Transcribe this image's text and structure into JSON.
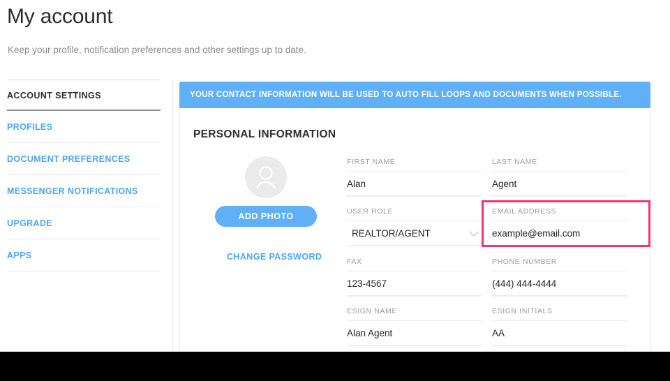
{
  "header": {
    "title": "My account",
    "subtitle": "Keep your profile, notification preferences and other settings up to date."
  },
  "sidebar": {
    "heading": "ACCOUNT SETTINGS",
    "items": [
      {
        "label": "PROFILES"
      },
      {
        "label": "DOCUMENT PREFERENCES"
      },
      {
        "label": "MESSENGER NOTIFICATIONS"
      },
      {
        "label": "UPGRADE"
      },
      {
        "label": "APPS"
      }
    ]
  },
  "card": {
    "banner": "YOUR CONTACT INFORMATION WILL BE USED TO AUTO FILL LOOPS AND DOCUMENTS WHEN POSSIBLE.",
    "section_title": "PERSONAL INFORMATION",
    "avatar": {
      "icon": "person-icon"
    },
    "add_photo_label": "ADD PHOTO",
    "change_password_label": "CHANGE PASSWORD",
    "fields": [
      {
        "label": "FIRST NAME",
        "value": "Alan"
      },
      {
        "label": "LAST NAME",
        "value": "Agent"
      },
      {
        "label": "USER ROLE",
        "value": "REALTOR/AGENT"
      },
      {
        "label": "EMAIL ADDRESS",
        "value": "example@email.com"
      },
      {
        "label": "FAX",
        "value": "123-4567"
      },
      {
        "label": "PHONE NUMBER",
        "value": "(444) 444-4444"
      },
      {
        "label": "ESIGN NAME",
        "value": "Alan Agent"
      },
      {
        "label": "ESIGN INITIALS",
        "value": "AA"
      }
    ]
  },
  "colors": {
    "accent_blue": "#61b0f7",
    "link_blue": "#4da6f0",
    "highlight_pink": "#f8326e",
    "focus_underline": "#8ec8f5",
    "text_dark": "#222222",
    "label_gray": "#9b9b9b",
    "bottom_bar": "#000000"
  }
}
